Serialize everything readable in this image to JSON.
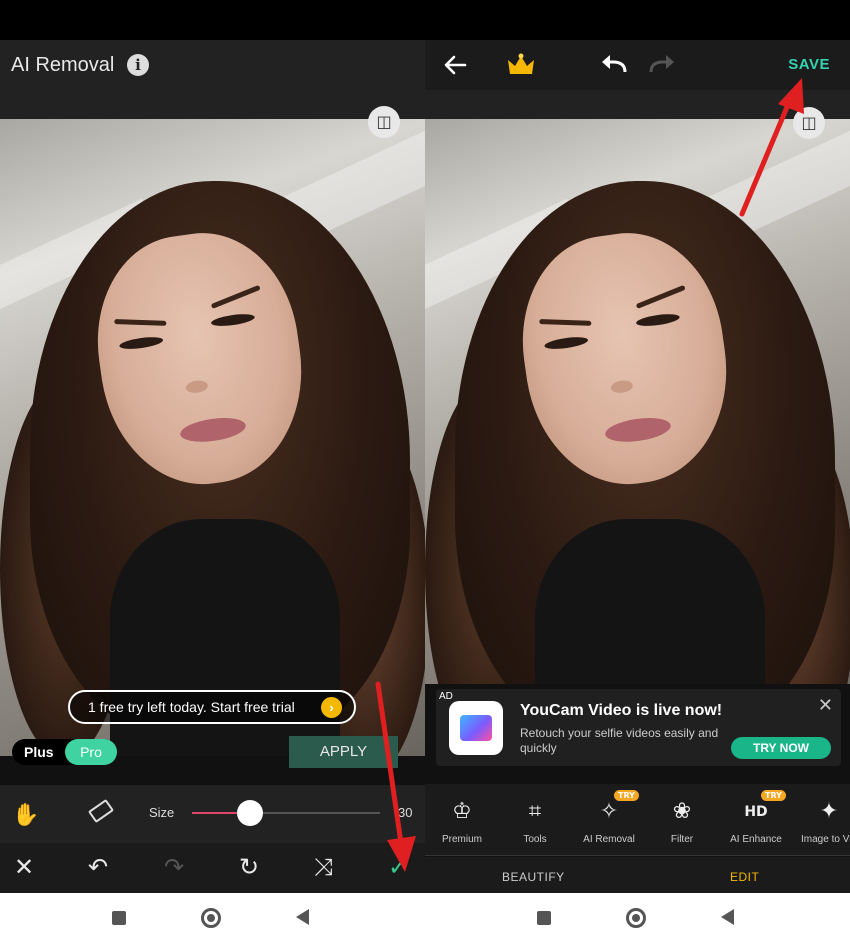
{
  "left": {
    "title": "AI Removal",
    "trial_text": "1 free try left today. Start free trial",
    "trial_arrow": "›",
    "plan_plus": "Plus",
    "plan_pro": "Pro",
    "apply_label": "APPLY",
    "size_label": "Size",
    "size_value": "30",
    "size_fraction": 0.31
  },
  "right": {
    "save_label": "SAVE",
    "ad": {
      "tag": "AD",
      "title": "YouCam Video is live now!",
      "description": "Retouch your selfie videos easily and quickly",
      "cta": "TRY NOW"
    },
    "features": [
      {
        "label": "Premium",
        "icon": "crown-outline-icon"
      },
      {
        "label": "Tools",
        "icon": "crop-icon"
      },
      {
        "label": "AI Removal",
        "icon": "sparkle-eraser-icon",
        "badge": "TRY"
      },
      {
        "label": "Filter",
        "icon": "filter-circles-icon"
      },
      {
        "label": "AI Enhance",
        "icon": "hd-icon",
        "badge": "TRY"
      },
      {
        "label": "Image to Vid",
        "icon": "image-to-video-icon"
      }
    ],
    "modes": {
      "beautify": "BEAUTIFY",
      "edit": "EDIT"
    }
  },
  "colors": {
    "accent_green": "#35d3b0",
    "edit_active": "#f5b800",
    "brush_pink": "#e0456a",
    "annotation_red": "#e02020"
  }
}
